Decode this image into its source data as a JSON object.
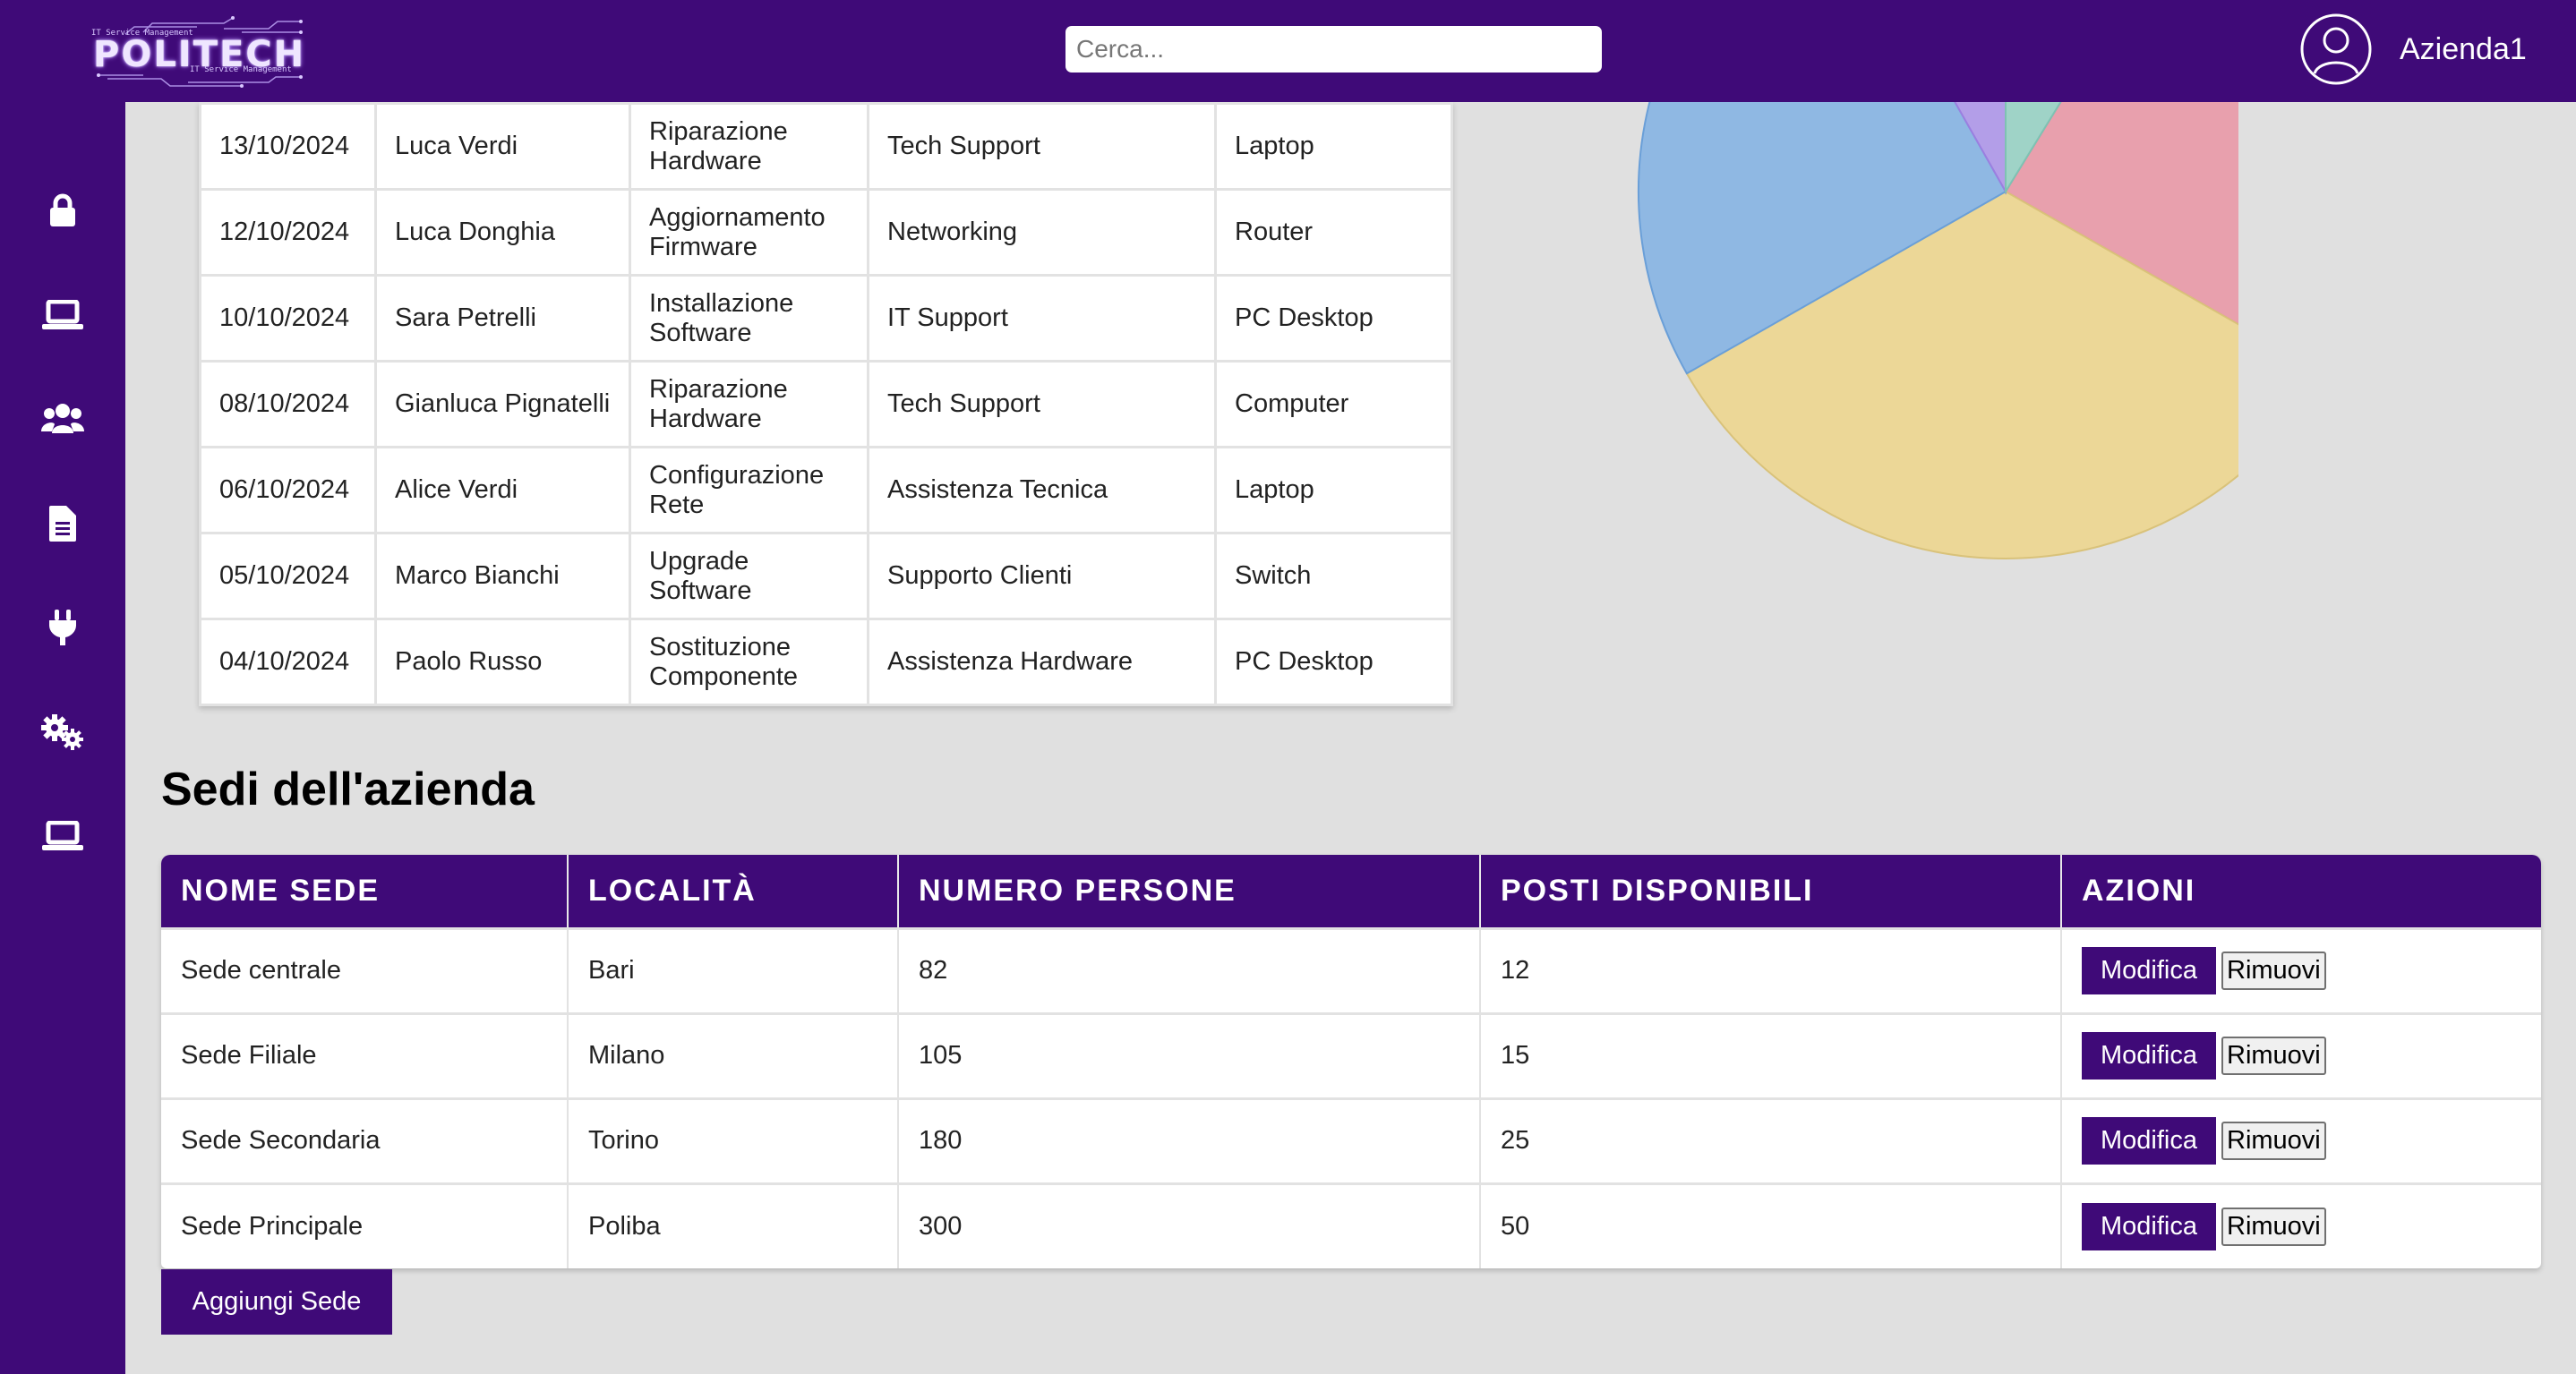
{
  "header": {
    "logo_text": "POLITECH",
    "logo_tagline": "IT Service Management",
    "search_placeholder": "Cerca...",
    "user_name": "Azienda1"
  },
  "sidebar": {
    "items": [
      {
        "icon": "lock-icon"
      },
      {
        "icon": "laptop-icon"
      },
      {
        "icon": "users-icon"
      },
      {
        "icon": "document-icon"
      },
      {
        "icon": "plug-icon"
      },
      {
        "icon": "gears-icon"
      },
      {
        "icon": "laptop-icon"
      }
    ]
  },
  "tickets": {
    "rows": [
      [
        "13/10/2024",
        "Luca Verdi",
        "Riparazione Hardware",
        "Tech Support",
        "Laptop"
      ],
      [
        "12/10/2024",
        "Luca Donghia",
        "Aggiornamento Firmware",
        "Networking",
        "Router"
      ],
      [
        "10/10/2024",
        "Sara Petrelli",
        "Installazione Software",
        "IT Support",
        "PC Desktop"
      ],
      [
        "08/10/2024",
        "Gianluca Pignatelli",
        "Riparazione Hardware",
        "Tech Support",
        "Computer"
      ],
      [
        "06/10/2024",
        "Alice Verdi",
        "Configurazione Rete",
        "Assistenza Tecnica",
        "Laptop"
      ],
      [
        "05/10/2024",
        "Marco Bianchi",
        "Upgrade Software",
        "Supporto Clienti",
        "Switch"
      ],
      [
        "04/10/2024",
        "Paolo Russo",
        "Sostituzione Componente",
        "Assistenza Hardware",
        "PC Desktop"
      ]
    ]
  },
  "pie_colors": {
    "purple": "#b39ee8",
    "teal": "#9fd3c7",
    "pink": "#e8a0ad",
    "yellow": "#ecd797",
    "blue": "#8fb8e3"
  },
  "sedi": {
    "title": "Sedi dell'azienda",
    "headers": [
      "Nome sede",
      "Località",
      "Numero persone",
      "Posti disponibili",
      "Azioni"
    ],
    "rows": [
      [
        "Sede centrale",
        "Bari",
        "82",
        "12"
      ],
      [
        "Sede Filiale",
        "Milano",
        "105",
        "15"
      ],
      [
        "Sede Secondaria",
        "Torino",
        "180",
        "25"
      ],
      [
        "Sede Principale",
        "Poliba",
        "300",
        "50"
      ]
    ],
    "edit_label": "Modifica",
    "remove_label": "Rimuovi",
    "add_label": "Aggiungi Sede"
  },
  "colors": {
    "brand": "#3f0a78",
    "background": "#e0e0e0"
  }
}
